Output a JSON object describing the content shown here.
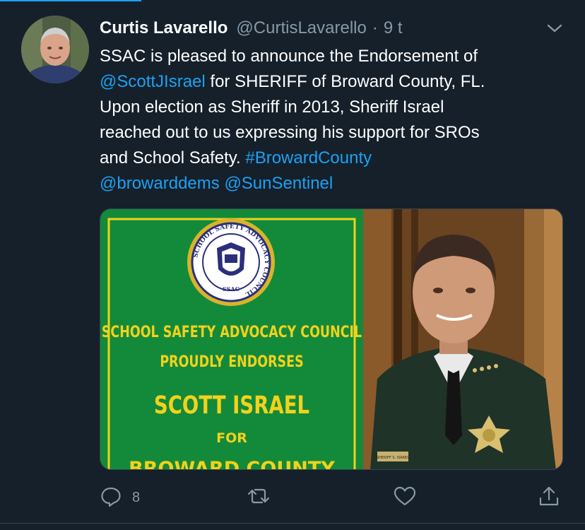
{
  "tweet": {
    "author": {
      "name": "Curtis Lavarello",
      "handle": "@CurtisLavarello",
      "dot": "·",
      "time": "9 t"
    },
    "text": {
      "line1": "SSAC is pleased to announce the Endorsement of",
      "mention_sheriff": "@ScottJIsrael",
      "line2_rest": " for SHERIFF of Broward County, FL.",
      "line3": "Upon election as Sheriff in 2013, Sheriff Israel",
      "line4": "reached out to us expressing his support for SROs",
      "line5": "and School Safety. ",
      "hashtag": "#BrowardCounty",
      "mention_dems": "@browarddems",
      "space": " ",
      "mention_sentinel": "@SunSentinel"
    },
    "media": {
      "seal_ring_text": "SCHOOL SAFETY ADVOCACY COUNCIL",
      "seal_abbr": "SSAC",
      "poster_line1": "SCHOOL SAFETY ADVOCACY COUNCIL",
      "poster_line2": "PROUDLY ENDORSES",
      "poster_line3": "SCOTT ISRAEL",
      "poster_line4": "FOR",
      "poster_line5": "BROWARD COUNTY",
      "nameplate": "SHERIFF S. ISRAEL"
    },
    "actions": {
      "reply_count": "8"
    }
  },
  "colors": {
    "background": "#15202b",
    "link": "#1da1f2",
    "muted": "#8899a6",
    "poster_green": "#138a3a",
    "poster_yellow": "#f2d21b"
  },
  "icons": [
    "chevron-down-icon",
    "reply-icon",
    "retweet-icon",
    "like-icon",
    "share-icon"
  ]
}
